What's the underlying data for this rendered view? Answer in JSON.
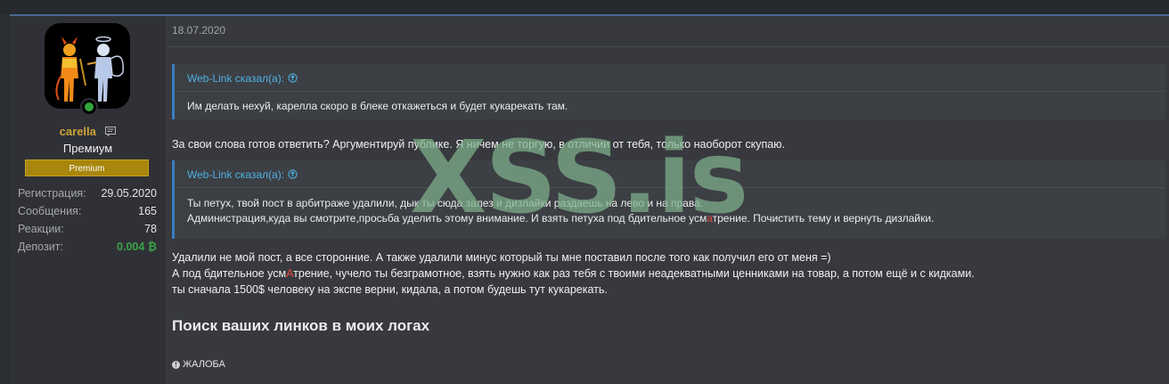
{
  "post": {
    "date": "18.07.2020",
    "author": {
      "username": "carella",
      "title": "Премиум",
      "badge": "Premium",
      "stats": [
        {
          "label": "Регистрация:",
          "value": "29.05.2020"
        },
        {
          "label": "Сообщения:",
          "value": "165"
        },
        {
          "label": "Реакции:",
          "value": "78"
        },
        {
          "label": "Депозит:",
          "value": "0.004 ₿"
        }
      ]
    },
    "quote1": {
      "author": "Web-Link сказал(а):",
      "text": "Им делать нехуй, карелла скоро в блеке откажеться и будет кукарекать там."
    },
    "reply1": "За свои слова готов ответить? Аргументируй публике. Я ничем не торгую, в отличии от тебя, только наоборот скупаю.",
    "quote2": {
      "author": "Web-Link сказал(а):",
      "line1": "Ты петух, твой пост в арбитраже удалили, дык ты сюда залез и дизлайки раздаешь на лево и на права.",
      "line2_pre": "Администрация,куда вы смотрите,просьба уделить этому внимание. И взять петуха под бдительное усм",
      "line2_red": "а",
      "line2_post": "трение. Почистить тему и вернуть дизлайки."
    },
    "reply2": {
      "line1": "Удалили не мой пост, а все сторонние. А также удалили минус который ты мне поставил после того как получил его от меня =)",
      "line2_pre": "А под бдительное усм",
      "line2_red": "А",
      "line2_post": "трение, чучело ты безграмотное, взять нужно как раз тебя с твоими неадекватными ценниками на товар, а потом ещё и с кидками.",
      "line3": "ты сначала 1500$ человеку на экспе верни, кидала, а потом будешь тут кукарекать."
    },
    "signature": "Поиск ваших линков в моих логах",
    "report_label": "ЖАЛОБА"
  },
  "watermark": "XSS.is",
  "colors": {
    "accent": "#3a7cc4",
    "username": "#cfa33a",
    "badge": "#a8870d",
    "deposit": "#3aa34a",
    "quote_author": "#4fb2e4",
    "highlight": "#e24a3c"
  }
}
